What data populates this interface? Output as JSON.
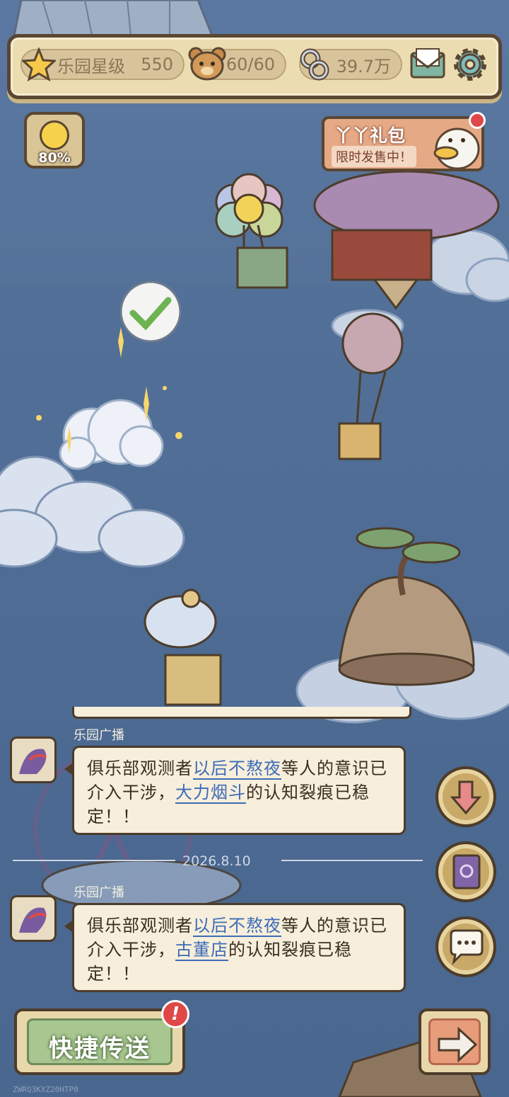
{
  "topbar": {
    "park_star_label": "乐园星级",
    "park_star_value": "550",
    "bear_value": "60/60",
    "chain_value": "39.7万",
    "icons": [
      "star-icon",
      "bear-icon",
      "chain-icon",
      "mail-icon",
      "gear-icon"
    ]
  },
  "mood": {
    "percent": "80%"
  },
  "gift": {
    "title": "丫丫礼包",
    "subtitle": "限时发售中！"
  },
  "chat": {
    "messages": [
      {
        "sender": "乐园广播",
        "prefix": "俱乐部观测者",
        "link1": "以后不熬夜",
        "middle": "等人的意识已介入干涉，",
        "link2": "大力烟斗",
        "suffix": "的认知裂痕已稳定！！"
      },
      {
        "sender": "乐园广播",
        "prefix": "俱乐部观测者",
        "link1": "以后不熬夜",
        "middle": "等人的意识已介入干涉，",
        "link2": "古董店",
        "suffix": "的认知裂痕已稳定！！"
      }
    ],
    "date": "2026.8.10"
  },
  "bottom": {
    "teleport_label": "快捷传送",
    "badge": "!"
  },
  "footer_code": "ZWRQ3KXZ20HTP0",
  "colors": {
    "sky": "#557299",
    "panel": "#ecdcb2",
    "outline": "#5a4632",
    "link": "#3d6bb8"
  }
}
